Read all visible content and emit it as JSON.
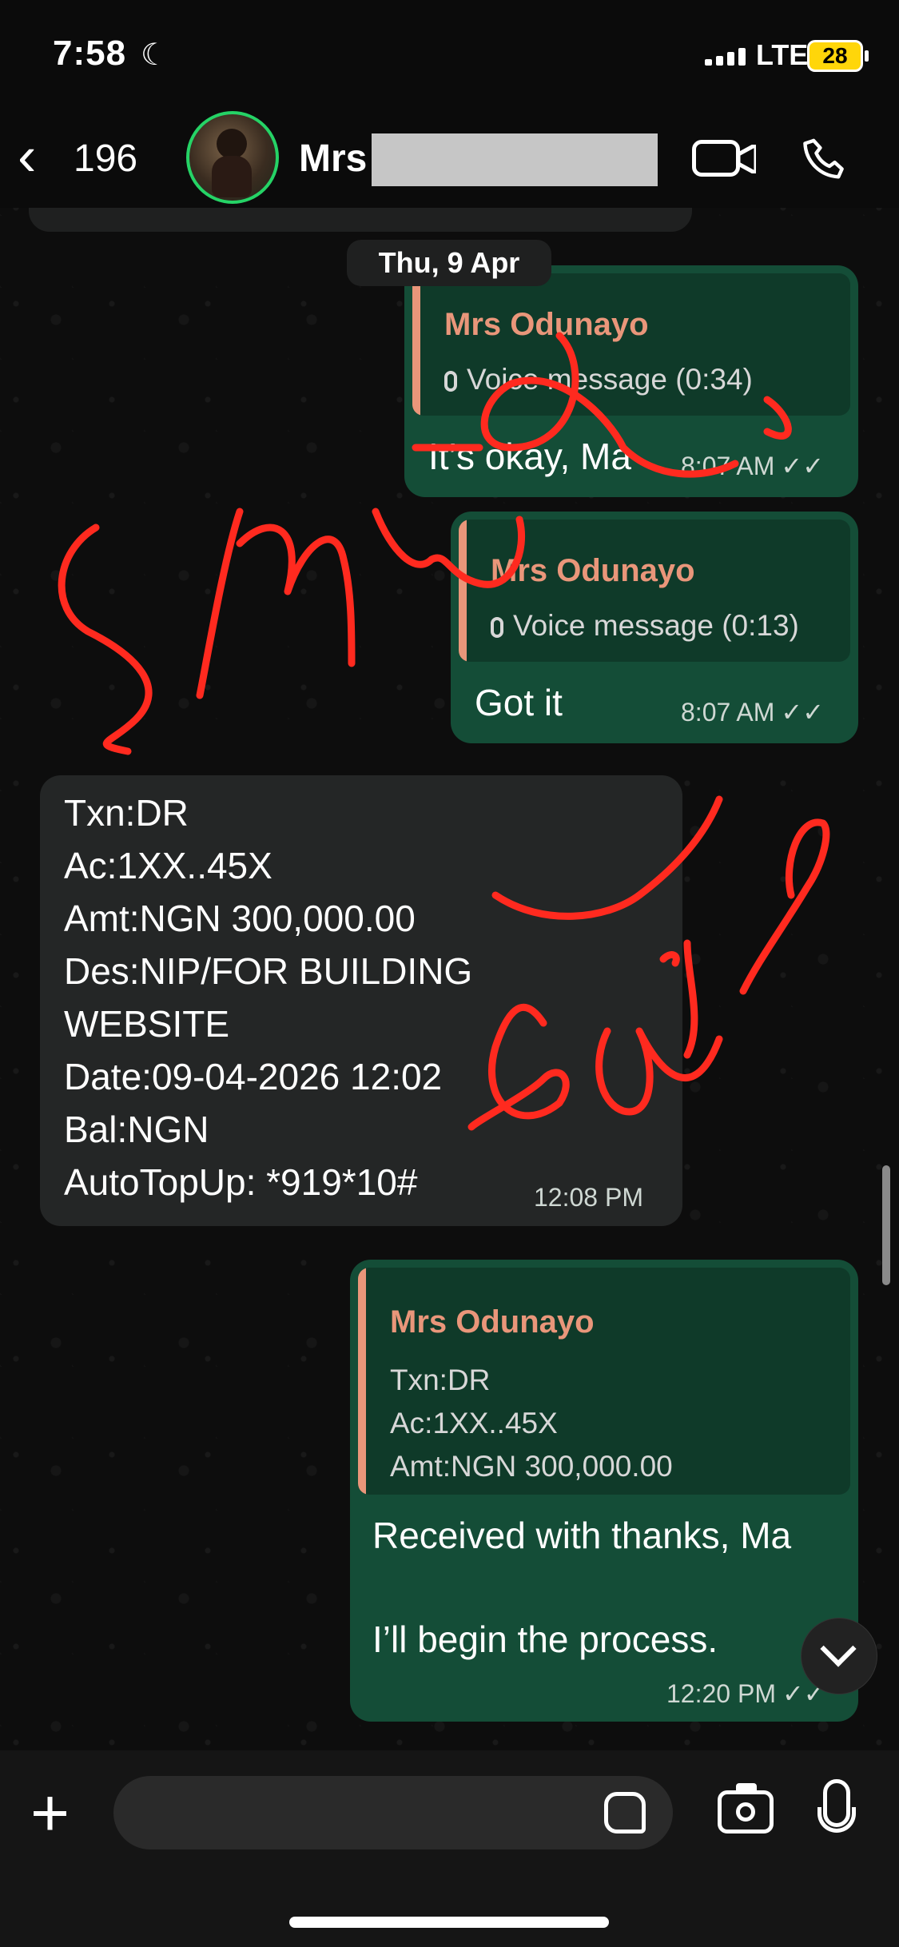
{
  "status_bar": {
    "time": "7:58",
    "network": "LTE",
    "battery": "28"
  },
  "header": {
    "back_count": "196",
    "contact_name": "Mrs"
  },
  "date_separator": "Thu, 9 Apr",
  "messages": [
    {
      "direction": "outgoing",
      "quote_name": "Mrs Odunayo",
      "quote_text": "Voice message (0:34)",
      "text": "It’s okay, Ma",
      "time": "8:07 AM"
    },
    {
      "direction": "outgoing",
      "quote_name": "Mrs Odunayo",
      "quote_text": "Voice message (0:13)",
      "text": "Got it",
      "time": "8:07 AM"
    },
    {
      "direction": "incoming",
      "lines": [
        "Txn:DR",
        "Ac:1XX..45X",
        "Amt:NGN 300,000.00",
        "Des:NIP/FOR BUILDING",
        "WEBSITE",
        "Date:09-04-2026 12:02",
        "Bal:NGN",
        "AutoTopUp: *919*10#"
      ],
      "time": "12:08 PM"
    },
    {
      "direction": "outgoing",
      "quote_name": "Mrs Odunayo",
      "quote_lines": [
        "Txn:DR",
        "Ac:1XX..45X",
        "Amt:NGN 300,000.00"
      ],
      "text_lines": [
        "Received with thanks, Ma",
        "I’ll begin the process."
      ],
      "time": "12:20 PM"
    }
  ],
  "colors": {
    "outgoing_bubble": "#144d37",
    "incoming_bubble": "#242626",
    "quote_accent": "#e9967a",
    "annotation": "#ff2a1f",
    "online_ring": "#25d366"
  },
  "icons": [
    "chevron-left-icon",
    "video-call-icon",
    "phone-icon",
    "mic-icon",
    "plus-icon",
    "sticker-icon",
    "camera-icon",
    "chevron-down-icon",
    "double-check-icon",
    "moon-icon",
    "signal-icon",
    "battery-icon"
  ]
}
